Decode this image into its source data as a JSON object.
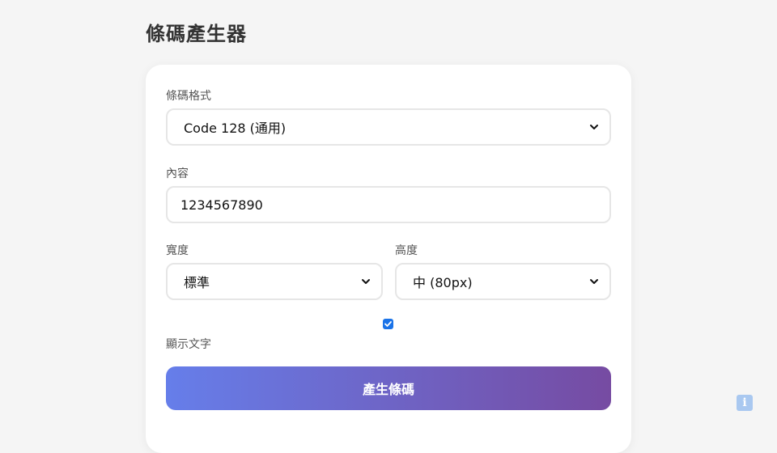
{
  "page": {
    "title": "條碼產生器"
  },
  "form": {
    "format": {
      "label": "條碼格式",
      "selected": "Code 128 (通用)"
    },
    "content": {
      "label": "內容",
      "value": "1234567890"
    },
    "width": {
      "label": "寬度",
      "selected": "標準"
    },
    "height": {
      "label": "高度",
      "selected": "中 (80px)"
    },
    "show_text": {
      "label": "顯示文字",
      "checked": true
    },
    "generate_label": "產生條碼"
  },
  "icons": {
    "chevron": "chevron-down-icon",
    "checkmark": "checkmark-icon",
    "info": "info-icon"
  },
  "colors": {
    "gradient_start": "#667eea",
    "gradient_end": "#764ba2",
    "checkbox": "#1a73e8",
    "info_badge": "#a9c8f0"
  }
}
